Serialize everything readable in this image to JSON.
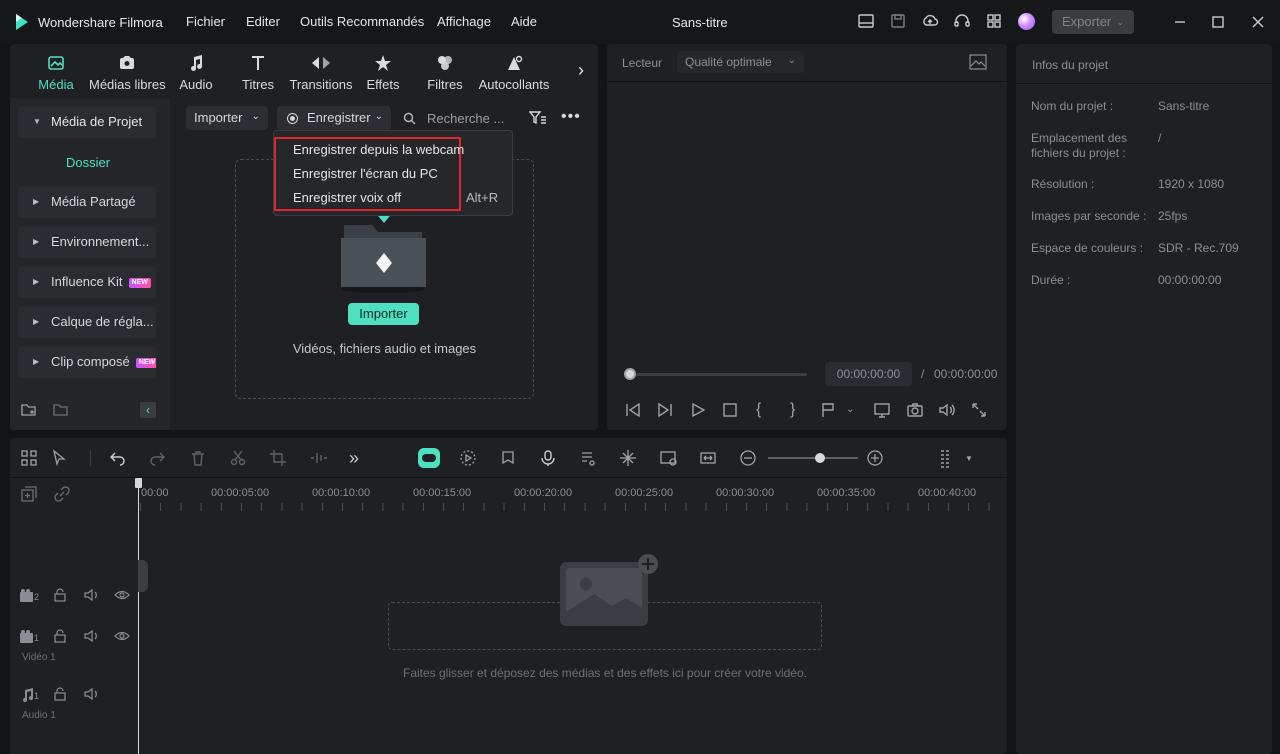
{
  "app": {
    "title": "Wondershare Filmora",
    "doc_title": "Sans-titre",
    "export_label": "Exporter"
  },
  "menu": [
    "Fichier",
    "Editer",
    "Outils Recommandés",
    "Affichage",
    "Aide"
  ],
  "tabs": [
    {
      "label": "Média",
      "icon": "media-icon"
    },
    {
      "label": "Médias libres",
      "icon": "stock-media-icon"
    },
    {
      "label": "Audio",
      "icon": "music-note-icon"
    },
    {
      "label": "Titres",
      "icon": "title-t-icon"
    },
    {
      "label": "Transitions",
      "icon": "transition-icon"
    },
    {
      "label": "Effets",
      "icon": "effects-star-icon"
    },
    {
      "label": "Filtres",
      "icon": "filters-icon"
    },
    {
      "label": "Autocollants",
      "icon": "sticker-icon"
    }
  ],
  "sidebar": {
    "project_media": "Média de Projet",
    "folder": "Dossier",
    "items": [
      {
        "label": "Média Partagé",
        "badge": ""
      },
      {
        "label": "Environnement...",
        "badge": ""
      },
      {
        "label": "Influence Kit",
        "badge": "NEW"
      },
      {
        "label": "Calque de régla...",
        "badge": ""
      },
      {
        "label": "Clip composé",
        "badge": "NEW"
      }
    ]
  },
  "media_toolbar": {
    "import_label": "Importer",
    "record_label": "Enregistrer",
    "search_placeholder": "Recherche ..."
  },
  "record_menu": {
    "items": [
      {
        "label": "Enregistrer depuis la webcam",
        "shortcut": ""
      },
      {
        "label": "Enregistrer l'écran du PC",
        "shortcut": ""
      },
      {
        "label": "Enregistrer voix off",
        "shortcut": "Alt+R"
      }
    ],
    "highlight_color": "#e0252b"
  },
  "dropzone": {
    "button": "Importer",
    "caption": "Vidéos, fichiers audio et images"
  },
  "player": {
    "label": "Lecteur",
    "quality": "Qualité optimale",
    "current_time": "00:00:00:00",
    "separator": "/",
    "total_time": "00:00:00:00"
  },
  "project_info": {
    "title": "Infos du projet",
    "rows": [
      {
        "label": "Nom du projet :",
        "value": "Sans-titre"
      },
      {
        "label": "Emplacement des fichiers du projet :",
        "value": "/"
      },
      {
        "label": "Résolution :",
        "value": "1920 x 1080"
      },
      {
        "label": "Images par seconde :",
        "value": "25fps"
      },
      {
        "label": "Espace de couleurs :",
        "value": "SDR - Rec.709"
      },
      {
        "label": "Durée :",
        "value": "00:00:00:00"
      }
    ]
  },
  "timeline": {
    "ruler": [
      "00:00",
      "00:00:05:00",
      "00:00:10:00",
      "00:00:15:00",
      "00:00:20:00",
      "00:00:25:00",
      "00:00:30:00",
      "00:00:35:00",
      "00:00:40:00"
    ],
    "tracks": [
      {
        "num": "2",
        "name": ""
      },
      {
        "num": "1",
        "name": "Vidéo 1"
      },
      {
        "num": "1",
        "name": "Audio 1"
      }
    ],
    "drop_hint": "Faites glisser et déposez des médias et des effets ici pour créer votre vidéo."
  },
  "colors": {
    "accent": "#4fe0c1",
    "background": "#121417",
    "panel": "#1e2024"
  }
}
